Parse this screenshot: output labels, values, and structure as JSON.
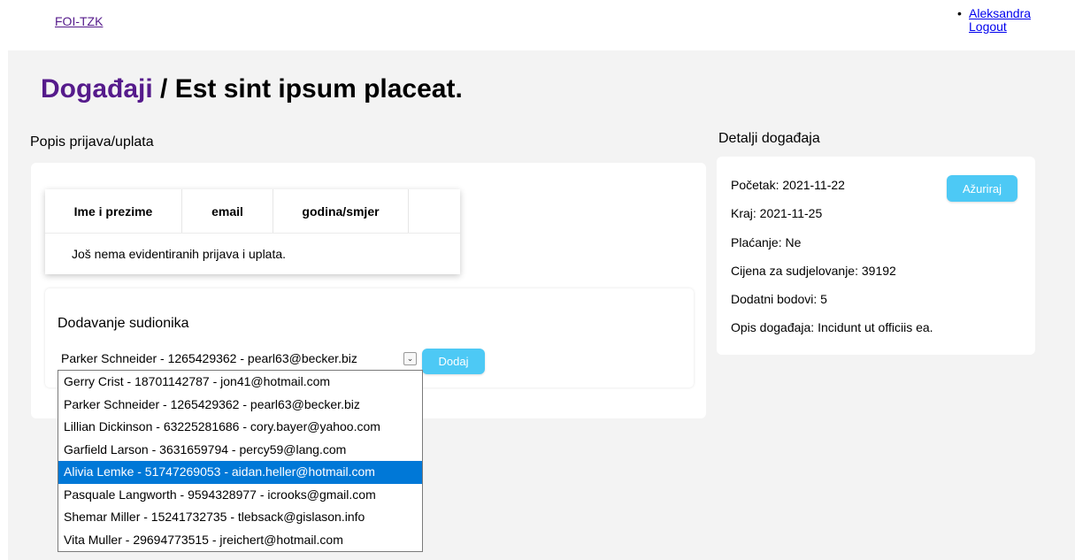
{
  "nav": {
    "brand": "FOI-TZK",
    "user": "Aleksandra",
    "logout": "Logout"
  },
  "title": {
    "crumb": "Događaji",
    "separator": " / ",
    "event": "Est sint ipsum placeat."
  },
  "registrations": {
    "heading": "Popis prijava/uplata",
    "columns": [
      "Ime i prezime",
      "email",
      "godina/smjer"
    ],
    "empty_message": "Još nema evidentiranih prijava i uplata."
  },
  "add_participant": {
    "heading": "Dodavanje sudionika",
    "selected": "Parker Schneider - 1265429362 - pearl63@becker.biz",
    "button": "Dodaj",
    "options": [
      "Gerry Crist - 18701142787 - jon41@hotmail.com",
      "Parker Schneider - 1265429362 - pearl63@becker.biz",
      "Lillian Dickinson - 63225281686 - cory.bayer@yahoo.com",
      "Garfield Larson - 3631659794 - percy59@lang.com",
      "Alivia Lemke - 51747269053 - aidan.heller@hotmail.com",
      "Pasquale Langworth - 9594328977 - icrooks@gmail.com",
      "Shemar Miller - 15241732735 - tlebsack@gislason.info",
      "Vita Muller - 29694773515 - jreichert@hotmail.com"
    ],
    "highlighted_index": 4
  },
  "details": {
    "heading": "Detalji događaja",
    "update_button": "Ažuriraj",
    "lines": [
      "Početak: 2021-11-22",
      "Kraj: 2021-11-25",
      "Plaćanje: Ne",
      "Cijena za sudjelovanje: 39192",
      "Dodatni bodovi: 5",
      "Opis događaja: Incidunt ut officiis ea."
    ]
  },
  "colors": {
    "accent": "#4dc9f5",
    "link": "#551a8b",
    "highlight": "#0078d7",
    "background": "#f3f3f3"
  }
}
